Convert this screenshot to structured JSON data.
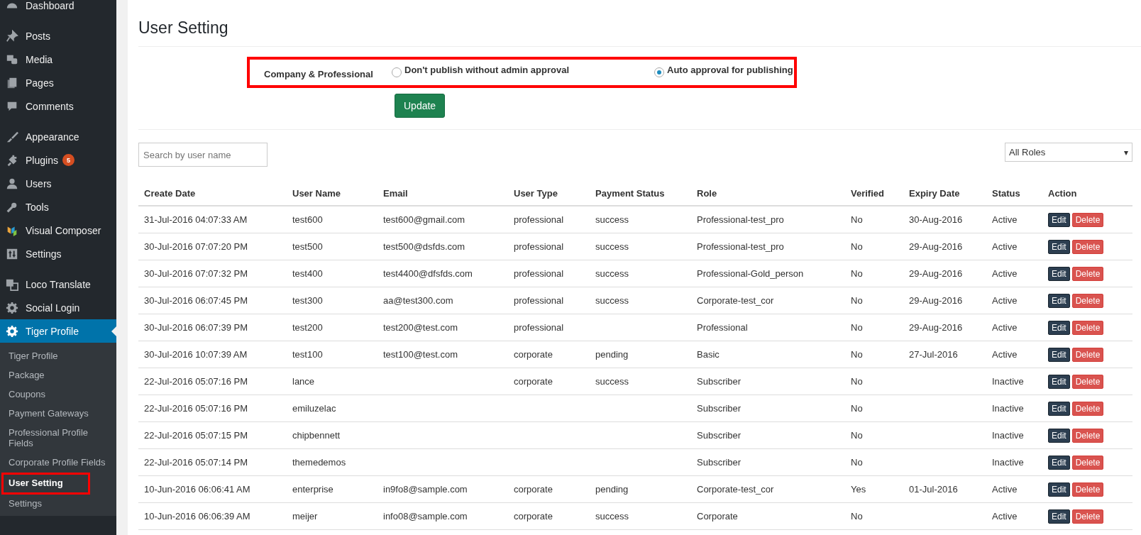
{
  "sidebar": {
    "groups": [
      [
        {
          "label": "Dashboard",
          "selected": false
        }
      ],
      [
        {
          "label": "Posts",
          "selected": false
        },
        {
          "label": "Media",
          "selected": false
        },
        {
          "label": "Pages",
          "selected": false
        },
        {
          "label": "Comments",
          "selected": false
        }
      ],
      [
        {
          "label": "Appearance",
          "selected": false
        },
        {
          "label": "Plugins",
          "selected": false,
          "badge": "5"
        },
        {
          "label": "Users",
          "selected": false
        },
        {
          "label": "Tools",
          "selected": false
        },
        {
          "label": "Visual Composer",
          "selected": false
        },
        {
          "label": "Settings",
          "selected": false
        }
      ],
      [
        {
          "label": "Loco Translate",
          "selected": false
        },
        {
          "label": "Social Login",
          "selected": false
        },
        {
          "label": "Tiger Profile",
          "selected": true,
          "children": [
            {
              "label": "Tiger Profile",
              "selected": false,
              "highlighted": false
            },
            {
              "label": "Package",
              "selected": false,
              "highlighted": false
            },
            {
              "label": "Coupons",
              "selected": false,
              "highlighted": false
            },
            {
              "label": "Payment Gateways",
              "selected": false,
              "highlighted": false
            },
            {
              "label": "Professional Profile Fields",
              "selected": false,
              "highlighted": false
            },
            {
              "label": "Corporate Profile Fields",
              "selected": false,
              "highlighted": false
            },
            {
              "label": "User Setting",
              "selected": true,
              "highlighted": true
            },
            {
              "label": "Settings",
              "selected": false,
              "highlighted": false
            }
          ]
        }
      ]
    ]
  },
  "page_title": "User Setting",
  "approval": {
    "label": "Company & Professional",
    "highlighted": true,
    "options": [
      {
        "label": "Don't publish without admin approval",
        "selected": false
      },
      {
        "label": "Auto approval for publishing",
        "selected": true
      }
    ],
    "button": "Update"
  },
  "search": {
    "placeholder": "Search by user name"
  },
  "role_filter": {
    "value": "All Roles",
    "caret": "▾"
  },
  "table": {
    "columns": [
      "Create Date",
      "User Name",
      "Email",
      "User Type",
      "Payment Status",
      "Role",
      "Verified",
      "Expiry Date",
      "Status",
      "Action"
    ],
    "rows": [
      {
        "cells": [
          "31-Jul-2016 04:07:33 AM",
          "test600",
          "test600@gmail.com",
          "professional",
          "success",
          "Professional-test_pro",
          "No",
          "30-Aug-2016",
          "Active"
        ],
        "actions": [
          "Edit",
          "Delete"
        ]
      },
      {
        "cells": [
          "30-Jul-2016 07:07:20 PM",
          "test500",
          "test500@dsfds.com",
          "professional",
          "success",
          "Professional-test_pro",
          "No",
          "29-Aug-2016",
          "Active"
        ],
        "actions": [
          "Edit",
          "Delete"
        ]
      },
      {
        "cells": [
          "30-Jul-2016 07:07:32 PM",
          "test400",
          "test4400@dfsfds.com",
          "professional",
          "success",
          "Professional-Gold_person",
          "No",
          "29-Aug-2016",
          "Active"
        ],
        "actions": [
          "Edit",
          "Delete"
        ]
      },
      {
        "cells": [
          "30-Jul-2016 06:07:45 PM",
          "test300",
          "aa@test300.com",
          "professional",
          "success",
          "Corporate-test_cor",
          "No",
          "29-Aug-2016",
          "Active"
        ],
        "actions": [
          "Edit",
          "Delete"
        ]
      },
      {
        "cells": [
          "30-Jul-2016 06:07:39 PM",
          "test200",
          "test200@test.com",
          "professional",
          "",
          "Professional",
          "No",
          "29-Aug-2016",
          "Active"
        ],
        "actions": [
          "Edit",
          "Delete"
        ]
      },
      {
        "cells": [
          "30-Jul-2016 10:07:39 AM",
          "test100",
          "test100@test.com",
          "corporate",
          "pending",
          "Basic",
          "No",
          "27-Jul-2016",
          "Active"
        ],
        "actions": [
          "Edit",
          "Delete"
        ]
      },
      {
        "cells": [
          "22-Jul-2016 05:07:16 PM",
          "lance",
          "",
          "corporate",
          "success",
          "Subscriber",
          "No",
          "",
          "Inactive"
        ],
        "actions": [
          "Edit",
          "Delete"
        ]
      },
      {
        "cells": [
          "22-Jul-2016 05:07:16 PM",
          "emiluzelac",
          "",
          "",
          "",
          "Subscriber",
          "No",
          "",
          "Inactive"
        ],
        "actions": [
          "Edit",
          "Delete"
        ]
      },
      {
        "cells": [
          "22-Jul-2016 05:07:15 PM",
          "chipbennett",
          "",
          "",
          "",
          "Subscriber",
          "No",
          "",
          "Inactive"
        ],
        "actions": [
          "Edit",
          "Delete"
        ]
      },
      {
        "cells": [
          "22-Jul-2016 05:07:14 PM",
          "themedemos",
          "",
          "",
          "",
          "Subscriber",
          "No",
          "",
          "Inactive"
        ],
        "actions": [
          "Edit",
          "Delete"
        ]
      },
      {
        "cells": [
          "10-Jun-2016 06:06:41 AM",
          "enterprise",
          "in9fo8@sample.com",
          "corporate",
          "pending",
          "Corporate-test_cor",
          "Yes",
          "01-Jul-2016",
          "Active"
        ],
        "actions": [
          "Edit",
          "Delete"
        ]
      },
      {
        "cells": [
          "10-Jun-2016 06:06:39 AM",
          "meijer",
          "info08@sample.com",
          "corporate",
          "success",
          "Corporate",
          "No",
          "",
          "Active"
        ],
        "actions": [
          "Edit",
          "Delete"
        ]
      }
    ]
  }
}
